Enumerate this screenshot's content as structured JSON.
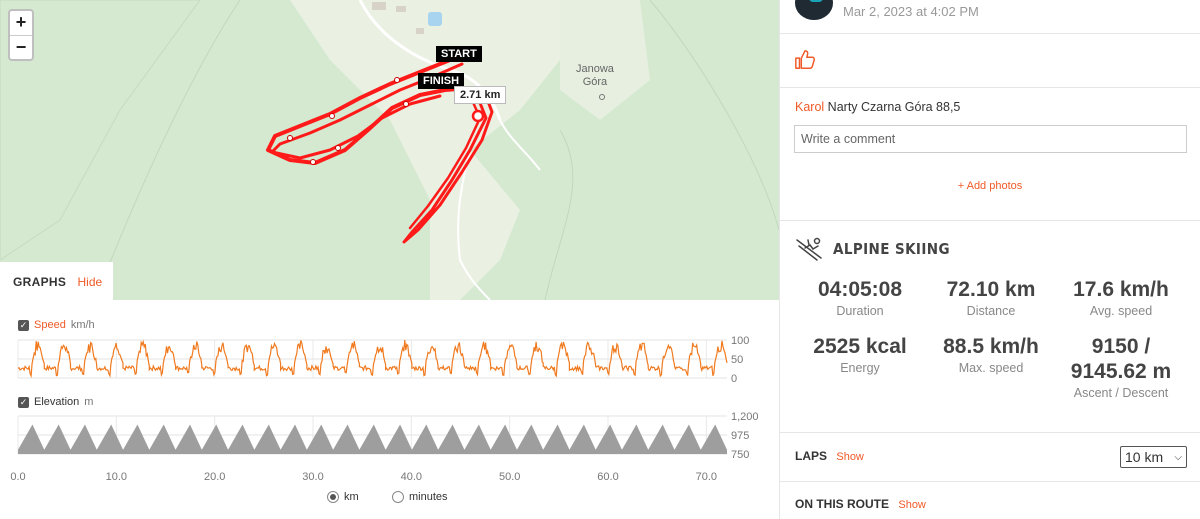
{
  "map": {
    "zoom_in": "+",
    "zoom_out": "−",
    "start_label": "START",
    "finish_label": "FINISH",
    "distance_label": "2.71 km",
    "place_name": "Janowa\nGóra",
    "route_color": "#ff0000"
  },
  "graphs": {
    "title": "GRAPHS",
    "hide_label": "Hide",
    "speed": {
      "label": "Speed",
      "unit": "km/h",
      "color": "#f07a1f",
      "y_ticks": [
        "100",
        "50",
        "0"
      ]
    },
    "elevation": {
      "label": "Elevation",
      "unit": "m",
      "color": "#9e9e9e",
      "y_ticks": [
        "1,200",
        "975",
        "750"
      ]
    },
    "x_ticks": [
      "0.0",
      "10.0",
      "20.0",
      "30.0",
      "40.0",
      "50.0",
      "60.0",
      "70.0"
    ],
    "unit_options": [
      {
        "label": "km",
        "selected": true
      },
      {
        "label": "minutes",
        "selected": false
      }
    ]
  },
  "chart_data": [
    {
      "type": "line",
      "title": "",
      "series": [
        {
          "name": "Speed",
          "pattern": "repeating ski runs, peaks approx 60-100 km/h, lift segments near 20-30 km/h"
        }
      ],
      "xlabel": "km",
      "ylabel": "km/h",
      "xlim": [
        0,
        72.1
      ],
      "ylim": [
        0,
        100
      ],
      "x_ticks": [
        0,
        10,
        20,
        30,
        40,
        50,
        60,
        70
      ],
      "y_ticks": [
        0,
        50,
        100
      ],
      "runs": 27
    },
    {
      "type": "area",
      "title": "",
      "series": [
        {
          "name": "Elevation",
          "pattern": "repeating triangular profile between ~800 m and ~1100 m"
        }
      ],
      "xlabel": "km",
      "ylabel": "m",
      "xlim": [
        0,
        72.1
      ],
      "ylim": [
        750,
        1200
      ],
      "x_ticks": [
        0,
        10,
        20,
        30,
        40,
        50,
        60,
        70
      ],
      "y_ticks": [
        750,
        975,
        1200
      ],
      "runs": 27,
      "min": 800,
      "max": 1100
    }
  ],
  "activity": {
    "date": "Mar 2, 2023 at 4:02 PM",
    "comment_author": "Karol",
    "comment_text": "Narty Czarna Góra 88,5",
    "comment_placeholder": "Write a comment",
    "add_photos": "+ Add photos",
    "sport": "ALPINE SKIING",
    "stats": [
      {
        "value": "04:05:08",
        "label": "Duration"
      },
      {
        "value": "72.10 km",
        "label": "Distance"
      },
      {
        "value": "17.6 km/h",
        "label": "Avg. speed"
      },
      {
        "value": "2525 kcal",
        "label": "Energy"
      },
      {
        "value": "88.5 km/h",
        "label": "Max. speed"
      },
      {
        "value": "9150 /\n9145.62 m",
        "label": "Ascent / Descent"
      }
    ],
    "laps_title": "LAPS",
    "laps_show": "Show",
    "laps_select": "10 km",
    "route_title": "ON THIS ROUTE",
    "route_show": "Show",
    "accent_color": "#f05a28"
  }
}
